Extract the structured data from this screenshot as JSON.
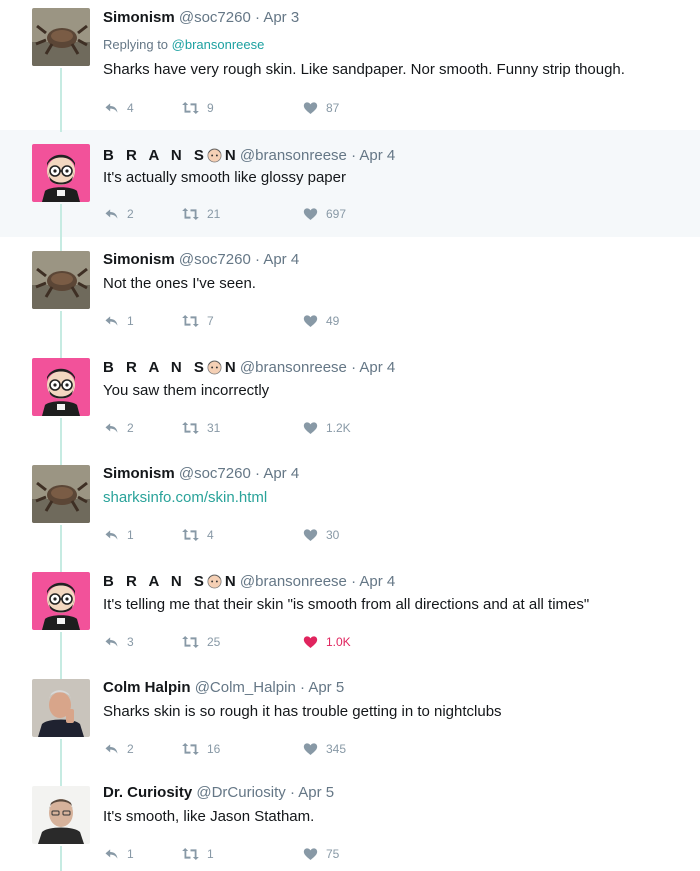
{
  "tweets": [
    {
      "name": "Simonism",
      "handle": "@soc7260",
      "dot": "·",
      "date": "Apr 3",
      "reply_prefix": "Replying to",
      "reply_to": "@bransonreese",
      "text": "Sharks have very rough skin. Like sandpaper. Nor smooth. Funny strip though.",
      "replies": "4",
      "retweets": "9",
      "likes": "87",
      "liked": false
    },
    {
      "name_a": "B R A N S",
      "name_b": "N",
      "handle": "@bransonreese",
      "dot": "·",
      "date": "Apr 4",
      "text": "It's actually smooth like glossy paper",
      "replies": "2",
      "retweets": "21",
      "likes": "697",
      "liked": false,
      "highlighted": true
    },
    {
      "name": "Simonism",
      "handle": "@soc7260",
      "dot": "·",
      "date": "Apr 4",
      "text": "Not the ones I've  seen.",
      "replies": "1",
      "retweets": "7",
      "likes": "49",
      "liked": false
    },
    {
      "name_a": "B R A N S",
      "name_b": "N",
      "handle": "@bransonreese",
      "dot": "·",
      "date": "Apr 4",
      "text": "You saw them incorrectly",
      "replies": "2",
      "retweets": "31",
      "likes": "1.2K",
      "liked": false
    },
    {
      "name": "Simonism",
      "handle": "@soc7260",
      "dot": "·",
      "date": "Apr 4",
      "text": "sharksinfo.com/skin.html",
      "replies": "1",
      "retweets": "4",
      "likes": "30",
      "liked": false
    },
    {
      "name_a": "B R A N S",
      "name_b": "N",
      "handle": "@bransonreese",
      "dot": "·",
      "date": "Apr 4",
      "text": "It's telling me that their skin \"is smooth from all directions and at all times\"",
      "replies": "3",
      "retweets": "25",
      "likes": "1.0K",
      "liked": true
    },
    {
      "name": "Colm Halpin",
      "handle": "@Colm_Halpin",
      "dot": "·",
      "date": "Apr 5",
      "text": "Sharks skin is so rough it has trouble getting in to nightclubs",
      "replies": "2",
      "retweets": "16",
      "likes": "345",
      "liked": false
    },
    {
      "name": "Dr. Curiosity",
      "handle": "@DrCuriosity",
      "dot": "·",
      "date": "Apr 5",
      "text": "It's smooth, like Jason Statham.",
      "replies": "1",
      "retweets": "1",
      "likes": "75",
      "liked": false
    }
  ],
  "colors": {
    "accent": "#1da1a1",
    "like_active": "#e0245e",
    "icon_gray": "#8899a6",
    "thread_line": "#c6ebe2",
    "highlight_bg": "#f5f8fa"
  },
  "icons": {
    "reply": "reply-icon",
    "retweet": "retweet-icon",
    "like": "heart-icon"
  }
}
